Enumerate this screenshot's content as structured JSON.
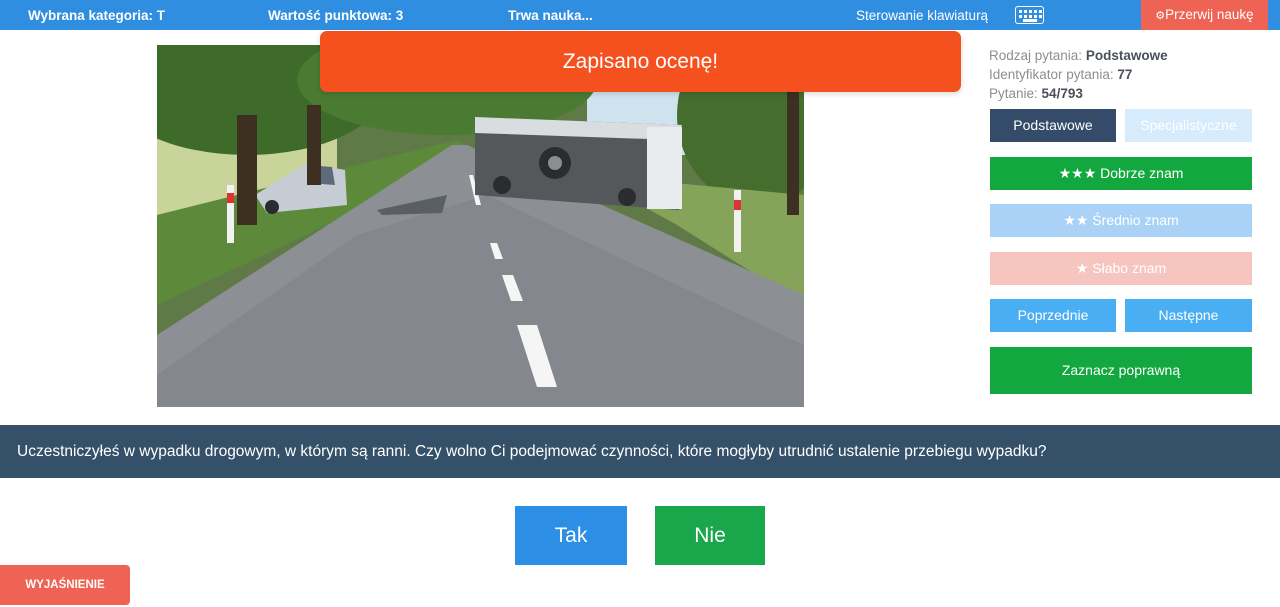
{
  "topbar": {
    "category": "Wybrana kategoria: T",
    "points": "Wartość punktowa: 3",
    "status": "Trwa nauka...",
    "keyboard_label": "Sterowanie klawiaturą",
    "stop_label": "Przerwij naukę",
    "stop_icon": "gears-icon",
    "keyboard_icon": "keyboard-icon"
  },
  "toast": {
    "message": "Zapisano ocenę!"
  },
  "info": {
    "type_label": "Rodzaj pytania:",
    "type_value": "Podstawowe",
    "id_label": "Identyfikator pytania:",
    "id_value": "77",
    "progress_label": "Pytanie:",
    "progress_value": "54/793"
  },
  "panel": {
    "basic": "Podstawowe",
    "specialist": "Specjalistyczne",
    "good": "★★★ Dobrze znam",
    "medium": "★★ Średnio znam",
    "weak": "★ Słabo znam",
    "prev": "Poprzednie",
    "next": "Następne",
    "mark_correct": "Zaznacz poprawną"
  },
  "question": {
    "text": "Uczestniczyłeś w wypadku drogowym, w którym są ranni. Czy wolno Ci podejmować czynności, które mogłyby utrudnić ustalenie przebiegu wypadku?"
  },
  "answers": {
    "yes": "Tak",
    "no": "Nie"
  },
  "explain": {
    "label": "WYJAŚNIENIE"
  },
  "colors": {
    "topbar": "#2f8ee0",
    "toast": "#f4511e",
    "dark": "#344c69",
    "green": "#12a83f",
    "blue": "#4aaef2",
    "red": "#ef6355"
  }
}
